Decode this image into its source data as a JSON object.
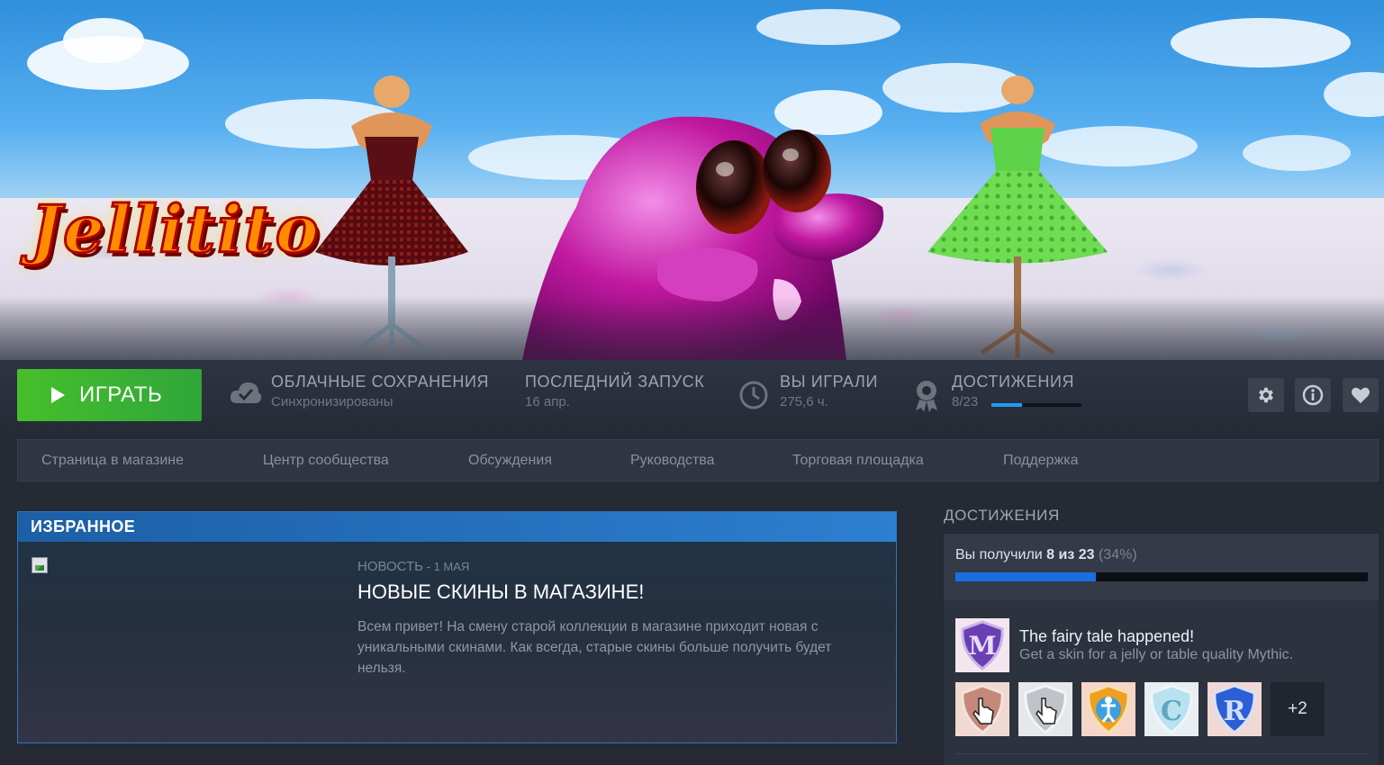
{
  "hero": {
    "game_logo": "Jellitito"
  },
  "actions": {
    "play_label": "ИГРАТЬ",
    "cloud": {
      "title": "ОБЛАЧНЫЕ СОХРАНЕНИЯ",
      "value": "Синхронизированы"
    },
    "last_launch": {
      "title": "ПОСЛЕДНИЙ ЗАПУСК",
      "value": "16 апр."
    },
    "playtime": {
      "title": "ВЫ ИГРАЛИ",
      "value": "275,6 ч."
    },
    "achievements": {
      "title": "ДОСТИЖЕНИЯ",
      "value": "8/23",
      "progress": 0.34
    },
    "icons": [
      "gear-icon",
      "info-icon",
      "heart-icon"
    ]
  },
  "nav": {
    "items": [
      "Страница в магазине",
      "Центр сообщества",
      "Обсуждения",
      "Руководства",
      "Торговая площадка",
      "Поддержка"
    ]
  },
  "featured": {
    "header": "ИЗБРАННОЕ",
    "news_type": "НОВОСТЬ",
    "news_date": " - 1 МАЯ",
    "title": "НОВЫЕ СКИНЫ В МАГАЗИНЕ!",
    "body": "Всем привет! На смену старой коллекции в магазине приходит новая с уникальными скинами. Как всегда, старые скины больше получить будет нельзя."
  },
  "achievements_panel": {
    "heading": "ДОСТИЖЕНИЯ",
    "summary_prefix": "Вы получили ",
    "summary_count": "8 из 23",
    "summary_pct": " (34%)",
    "progress": 0.34,
    "latest": {
      "letter": "M",
      "name": "The fairy tale happened!",
      "description": "Get a skin for a jelly or table quality Mythic."
    },
    "more_label": "+2",
    "accent": "#1a9fff"
  }
}
